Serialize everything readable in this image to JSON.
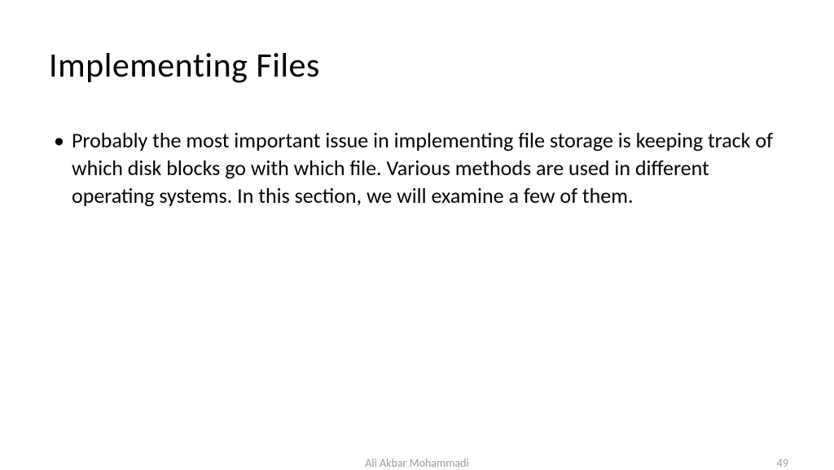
{
  "slide": {
    "title": "Implementing Files",
    "bullets": [
      "Probably the most important issue in implementing file storage is keeping track of which disk blocks go with which file. Various methods are used in different operating systems. In this section, we will examine a few of them."
    ]
  },
  "footer": {
    "author": "Ali Akbar Mohammadi",
    "page_number": "49"
  }
}
